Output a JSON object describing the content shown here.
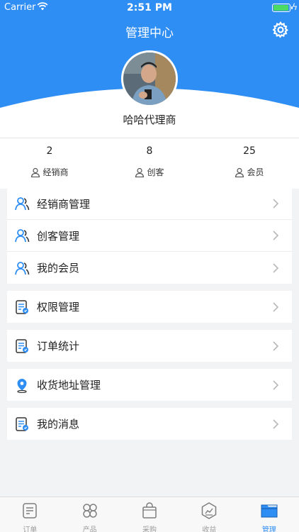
{
  "status_bar": {
    "carrier": "Carrier",
    "time": "2:51 PM"
  },
  "header": {
    "title": "管理中心",
    "agent_name": "哈哈代理商"
  },
  "stats": [
    {
      "value": "2",
      "label": "经销商"
    },
    {
      "value": "8",
      "label": "创客"
    },
    {
      "value": "25",
      "label": "会员"
    }
  ],
  "menu": {
    "dealer_management": "经销商管理",
    "maker_management": "创客管理",
    "my_members": "我的会员",
    "permission_management": "权限管理",
    "order_statistics": "订单统计",
    "address_management": "收货地址管理",
    "my_messages": "我的消息"
  },
  "tabbar": {
    "orders": "订单",
    "products": "产品",
    "purchase": "采购",
    "earnings": "收益",
    "management": "管理"
  },
  "colors": {
    "accent": "#2f8ef4",
    "battery": "#4cd964"
  }
}
